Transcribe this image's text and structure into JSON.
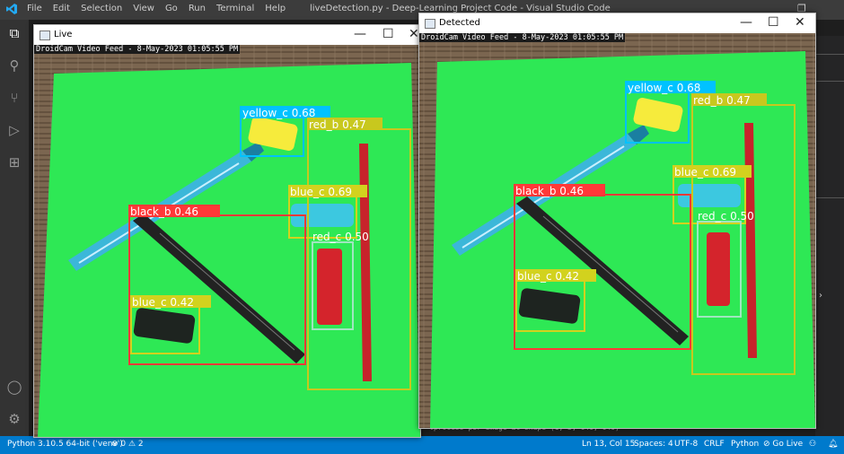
{
  "vscode": {
    "menu": [
      "File",
      "Edit",
      "Selection",
      "View",
      "Go",
      "Run",
      "Terminal",
      "Help"
    ],
    "window_title": "liveDetection.py - Deep-Learning Project Code - Visual Studio Code",
    "status": {
      "interpreter": "Python 3.10.5 64-bit ('venv')",
      "problems": "⊗ 0 ⚠ 2",
      "position": "Ln 13, Col 15",
      "spaces": "Spaces: 4",
      "encoding": "UTF-8",
      "eol": "CRLF",
      "language": "Python",
      "golive": "⊘ Go Live"
    },
    "terminal_line": "tprocess per image at shape (1, 3, 640, 640)"
  },
  "live_window": {
    "title": "Live",
    "caption": "DroidCam Video Feed - 8-May-2023 01:05:55 PM",
    "detections": [
      {
        "label": "yellow_c 0.68",
        "color": "#00c2ff"
      },
      {
        "label": "red_b 0.47",
        "color": "#c8c81e"
      },
      {
        "label": "blue_c 0.69",
        "color": "#d2d21e"
      },
      {
        "label": "red_c 0.50",
        "color": "#a0e6c0"
      },
      {
        "label": "black_b 0.46",
        "color": "#ff3838"
      },
      {
        "label": "blue_c 0.42",
        "color": "#d2d21e"
      }
    ]
  },
  "detected_window": {
    "title": "Detected",
    "caption": "DroidCam Video Feed - 8-May-2023 01:05:55 PM",
    "detections": [
      {
        "label": "yellow_c 0.68",
        "color": "#00c2ff"
      },
      {
        "label": "red_b 0.47",
        "color": "#c8c81e"
      },
      {
        "label": "blue_c 0.69",
        "color": "#d2d21e"
      },
      {
        "label": "red_c 0.50",
        "color": "#a0e6c0"
      },
      {
        "label": "black_b 0.46",
        "color": "#ff3838"
      },
      {
        "label": "blue_c 0.42",
        "color": "#d2d21e"
      }
    ]
  }
}
